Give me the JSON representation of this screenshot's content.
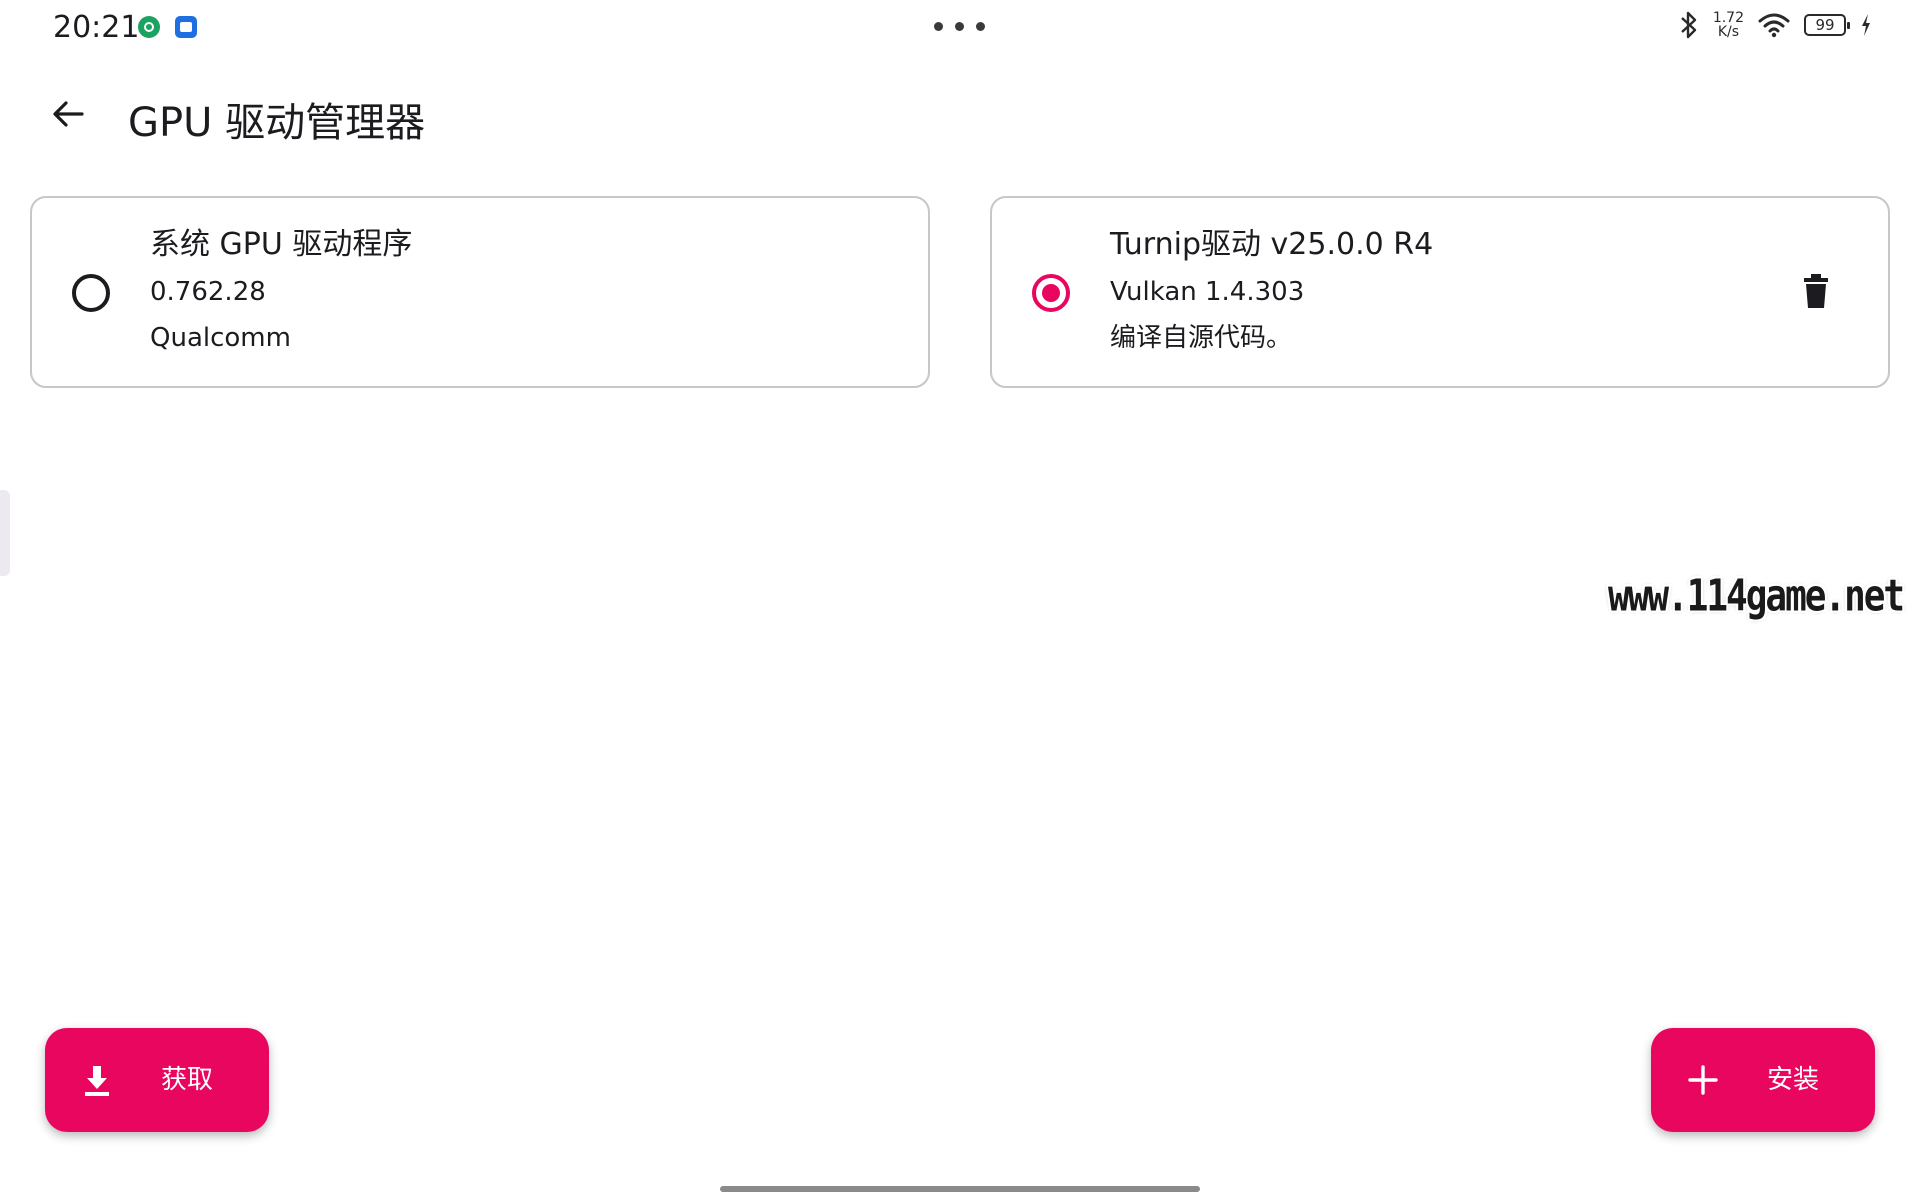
{
  "status_bar": {
    "time": "20:21",
    "net_speed_value": "1.72",
    "net_speed_unit": "K/s",
    "battery_level": "99"
  },
  "top_bar": {
    "title": "GPU 驱动管理器"
  },
  "drivers": [
    {
      "title": "系统 GPU 驱动程序",
      "version": "0.762.28",
      "description": "Qualcomm",
      "selected": false
    },
    {
      "title": "Turnip驱动 v25.0.0 R4",
      "version": "Vulkan 1.4.303",
      "description": "编译自源代码。",
      "selected": true
    }
  ],
  "watermark": "www.114game.net",
  "fab": {
    "fetch_label": "获取",
    "install_label": "安装"
  },
  "colors": {
    "accent": "#e8065f",
    "card_border": "#c9c5c9"
  },
  "icons": [
    "back-arrow-icon",
    "delete-icon",
    "download-icon",
    "plus-icon",
    "bluetooth-icon",
    "wifi-icon",
    "battery-icon",
    "charging-icon"
  ]
}
